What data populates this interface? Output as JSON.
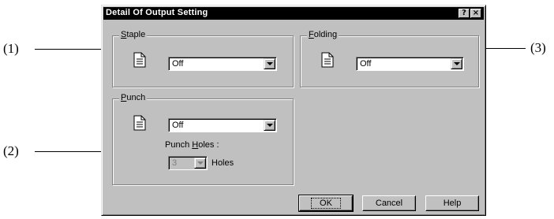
{
  "dialog": {
    "title": "Detail Of Output Setting",
    "help_glyph": "?",
    "close_glyph": "×"
  },
  "callouts": {
    "c1": "(1)",
    "c2": "(2)",
    "c3": "(3)"
  },
  "staple": {
    "label_mnemonic": "S",
    "label_rest": "taple",
    "value": "Off",
    "icon": "document-icon"
  },
  "folding": {
    "label_mnemonic": "F",
    "label_rest": "olding",
    "value": "Off",
    "icon": "document-icon"
  },
  "punch": {
    "label_mnemonic": "P",
    "label_rest": "unch",
    "value": "Off",
    "icon": "document-icon",
    "holes_label_prefix": "Punch ",
    "holes_label_mnemonic": "H",
    "holes_label_suffix": "oles :",
    "holes_value": "3",
    "holes_unit": "Holes",
    "holes_enabled": false
  },
  "buttons": {
    "ok": "OK",
    "cancel": "Cancel",
    "help": "Help"
  },
  "colors": {
    "face": "#c0c0c0",
    "titlebar": "#000000",
    "disabled_text": "#808080"
  }
}
